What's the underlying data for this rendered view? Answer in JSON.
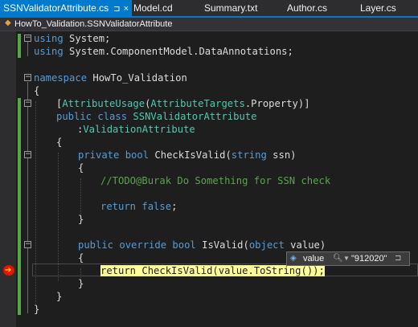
{
  "tabs": [
    {
      "label": "SSNValidatorAttribute.cs",
      "pin": "⊐",
      "close": "×"
    },
    {
      "label": "Model.cd"
    },
    {
      "label": "Summary.txt"
    },
    {
      "label": "Author.cs"
    },
    {
      "label": "Layer.cs"
    }
  ],
  "navbar": {
    "path": "HowTo_Validation.SSNValidatorAttribute",
    "icon": "class-icon"
  },
  "code": {
    "l1": {
      "kw": "using",
      "rest": " System;"
    },
    "l2": {
      "kw": "using",
      "rest": " System.ComponentModel.DataAnnotations;"
    },
    "l3": {
      "kw": "namespace",
      "rest": " HowTo_Validation"
    },
    "l4": "{",
    "l5": {
      "open": "[",
      "t1": "AttributeUsage",
      "p1": "(",
      "t2": "AttributeTargets",
      "rest": ".Property)]"
    },
    "l6": {
      "kw1": "public",
      "kw2": " class",
      "name": " SSNValidatorAttribute"
    },
    "l7": {
      "colon": ":",
      "base": "ValidationAttribute"
    },
    "l8": "{",
    "l9": {
      "kw1": "private",
      "kw2": " bool",
      "name": " CheckIsValid(",
      "kw3": "string",
      "rest": " ssn)"
    },
    "l10": "{",
    "l11": "//TODO@Burak Do Something for SSN check",
    "l12": {
      "kw": "return",
      "kw2": " false",
      "rest": ";"
    },
    "l13": "}",
    "l14": {
      "kw1": "public",
      "kw2": " override",
      "kw3": " bool",
      "name": " IsValid(",
      "kw4": "object",
      "rest": " value)"
    },
    "l15": "{",
    "l16": {
      "kw": "return",
      "rest": " CheckIsValid(value.ToString());"
    },
    "l17": "}",
    "l18": "}",
    "l19": "}"
  },
  "datatip": {
    "name": "value",
    "value": "\"912020\""
  }
}
